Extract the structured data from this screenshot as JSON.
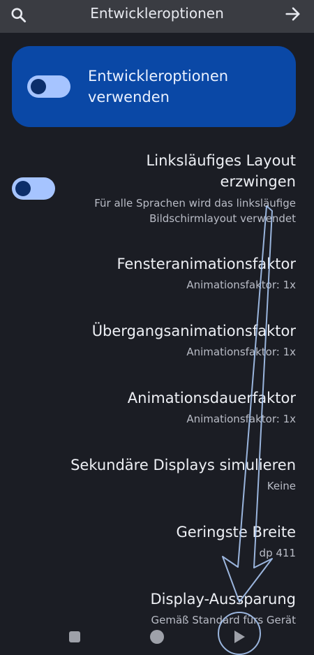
{
  "header": {
    "title": "Entwickleroptionen",
    "search_icon": "search-icon",
    "forward_icon": "arrow-right-icon"
  },
  "master_toggle": {
    "label": "Entwickleroptionen verwenden",
    "enabled": true
  },
  "settings": [
    {
      "title": "Linksläufiges Layout erzwingen",
      "subtitle": "Für alle Sprachen wird das linksläufige Bildschirmlayout verwendet",
      "toggle": true
    },
    {
      "title": "Fensteranimationsfaktor",
      "subtitle": "Animationsfaktor: 1x"
    },
    {
      "title": "Übergangsanimationsfaktor",
      "subtitle": "Animationsfaktor: 1x"
    },
    {
      "title": "Animationsdauerfaktor",
      "subtitle": "Animationsfaktor: 1x"
    },
    {
      "title": "Sekundäre Displays simulieren",
      "subtitle": "Keine"
    },
    {
      "title": "Geringste Breite",
      "subtitle": "dp 411"
    },
    {
      "title": "Display-Aussparung",
      "subtitle": "Gemäß Standard fürs Gerät"
    }
  ],
  "colors": {
    "background": "#1b1d24",
    "topbar": "#3a3c42",
    "accent_card": "#0a48a6",
    "toggle_track": "#a6c4ff",
    "toggle_thumb": "#0c2e6a"
  },
  "navbar": {
    "recents_icon": "square-icon",
    "home_icon": "circle-icon",
    "back_icon": "play-icon"
  }
}
